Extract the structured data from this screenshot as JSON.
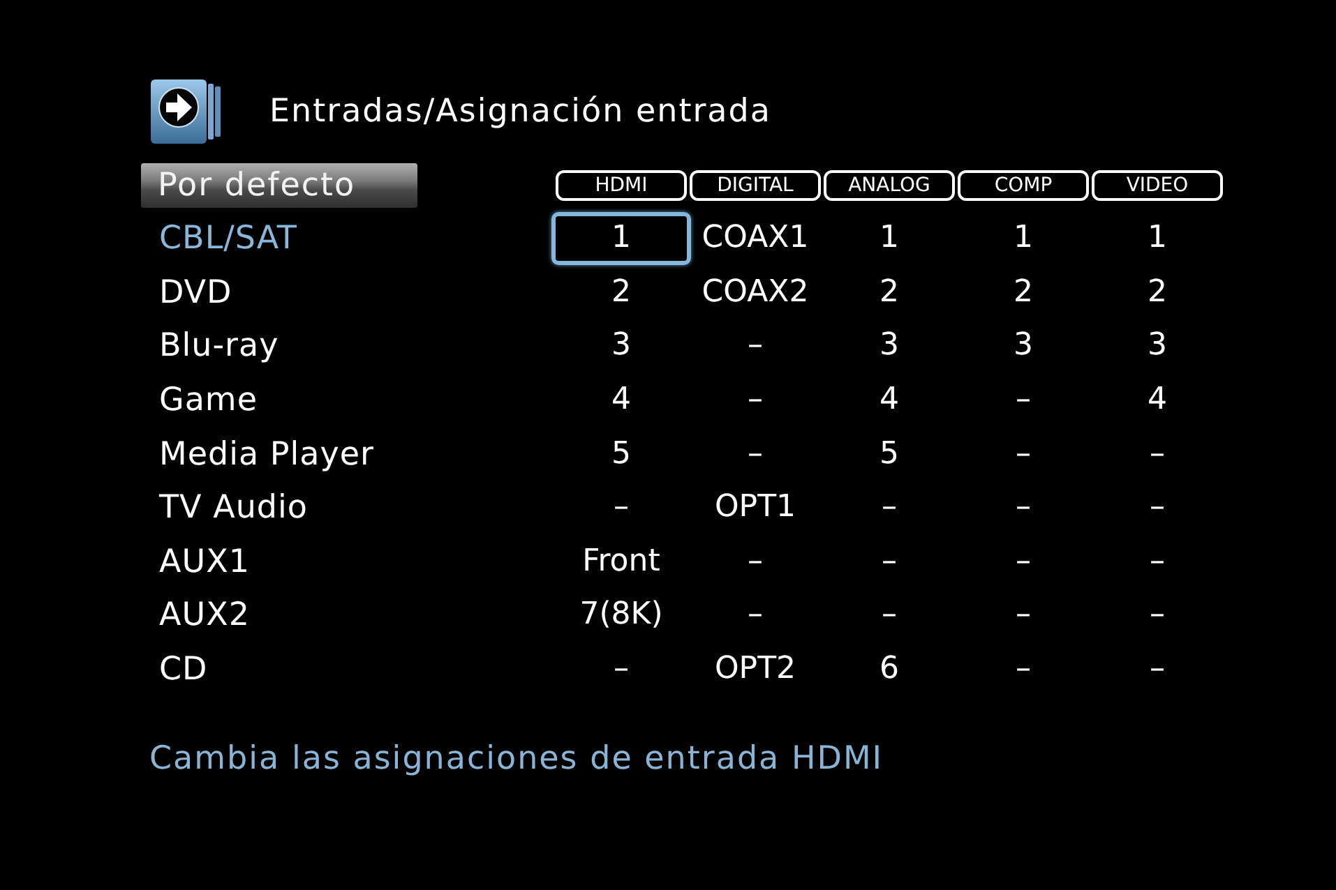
{
  "header": {
    "title": "Entradas/Asignación entrada"
  },
  "default_button": {
    "label": "Por defecto"
  },
  "columns": [
    {
      "label": "HDMI"
    },
    {
      "label": "DIGITAL"
    },
    {
      "label": "ANALOG"
    },
    {
      "label": "COMP"
    },
    {
      "label": "VIDEO"
    }
  ],
  "rows": [
    {
      "label": "CBL/SAT",
      "selected": true,
      "cells": [
        {
          "value": "1",
          "selected": true
        },
        {
          "value": "COAX1",
          "selected": false
        },
        {
          "value": "1",
          "selected": false
        },
        {
          "value": "1",
          "selected": false
        },
        {
          "value": "1",
          "selected": false
        }
      ]
    },
    {
      "label": "DVD",
      "selected": false,
      "cells": [
        {
          "value": "2",
          "selected": false
        },
        {
          "value": "COAX2",
          "selected": false
        },
        {
          "value": "2",
          "selected": false
        },
        {
          "value": "2",
          "selected": false
        },
        {
          "value": "2",
          "selected": false
        }
      ]
    },
    {
      "label": "Blu-ray",
      "selected": false,
      "cells": [
        {
          "value": "3",
          "selected": false
        },
        {
          "value": "–",
          "selected": false
        },
        {
          "value": "3",
          "selected": false
        },
        {
          "value": "3",
          "selected": false
        },
        {
          "value": "3",
          "selected": false
        }
      ]
    },
    {
      "label": "Game",
      "selected": false,
      "cells": [
        {
          "value": "4",
          "selected": false
        },
        {
          "value": "–",
          "selected": false
        },
        {
          "value": "4",
          "selected": false
        },
        {
          "value": "–",
          "selected": false
        },
        {
          "value": "4",
          "selected": false
        }
      ]
    },
    {
      "label": "Media Player",
      "selected": false,
      "cells": [
        {
          "value": "5",
          "selected": false
        },
        {
          "value": "–",
          "selected": false
        },
        {
          "value": "5",
          "selected": false
        },
        {
          "value": "–",
          "selected": false
        },
        {
          "value": "–",
          "selected": false
        }
      ]
    },
    {
      "label": "TV Audio",
      "selected": false,
      "cells": [
        {
          "value": "–",
          "selected": false
        },
        {
          "value": "OPT1",
          "selected": false
        },
        {
          "value": "–",
          "selected": false
        },
        {
          "value": "–",
          "selected": false
        },
        {
          "value": "–",
          "selected": false
        }
      ]
    },
    {
      "label": "AUX1",
      "selected": false,
      "cells": [
        {
          "value": "Front",
          "selected": false
        },
        {
          "value": "–",
          "selected": false
        },
        {
          "value": "–",
          "selected": false
        },
        {
          "value": "–",
          "selected": false
        },
        {
          "value": "–",
          "selected": false
        }
      ]
    },
    {
      "label": "AUX2",
      "selected": false,
      "cells": [
        {
          "value": "7(8K)",
          "selected": false
        },
        {
          "value": "–",
          "selected": false
        },
        {
          "value": "–",
          "selected": false
        },
        {
          "value": "–",
          "selected": false
        },
        {
          "value": "–",
          "selected": false
        }
      ]
    },
    {
      "label": "CD",
      "selected": false,
      "cells": [
        {
          "value": "–",
          "selected": false
        },
        {
          "value": "OPT2",
          "selected": false
        },
        {
          "value": "6",
          "selected": false
        },
        {
          "value": "–",
          "selected": false
        },
        {
          "value": "–",
          "selected": false
        }
      ]
    }
  ],
  "help_text": "Cambia las asignaciones de entrada HDMI"
}
